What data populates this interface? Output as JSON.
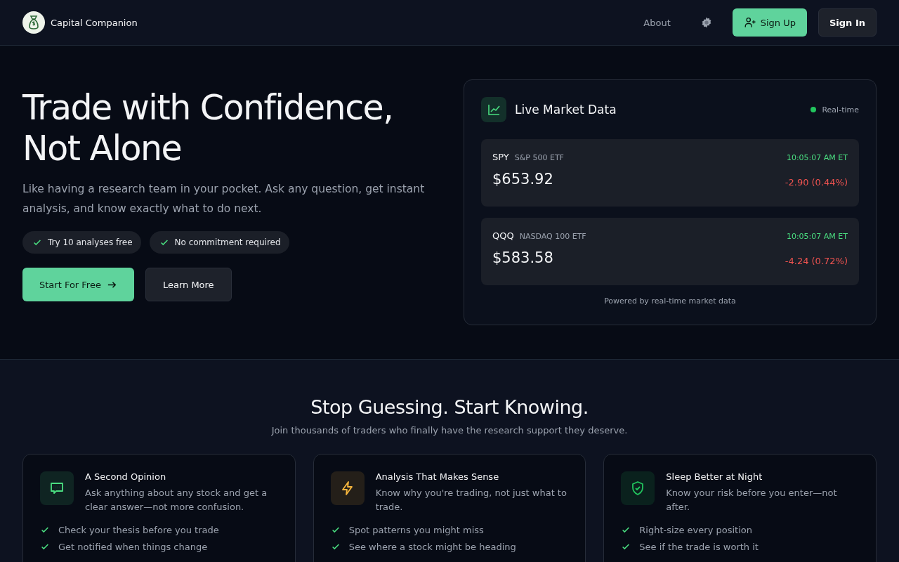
{
  "header": {
    "brand": "Capital Companion",
    "nav": [
      {
        "label": "About"
      }
    ],
    "sign_up": "Sign Up",
    "sign_in": "Sign In"
  },
  "hero": {
    "title_lines": [
      "Trade with Confidence,",
      "Not Alone"
    ],
    "subtitle": "Like having a research team in your pocket. Ask any question, get instant analysis, and know exactly what to do next.",
    "badges": [
      "Try 10 analyses free",
      "No commitment required"
    ],
    "primary_button": "Start For Free",
    "secondary_button": "Learn More"
  },
  "market": {
    "title": "Live Market Data",
    "status": "Real-time",
    "live": true,
    "quotes": [
      {
        "symbol": "SPY",
        "name": "S&P 500 ETF",
        "time": "10:05:07 AM ET",
        "price": "$653.92",
        "change": "-2.90 (0.44%)",
        "negative": true
      },
      {
        "symbol": "QQQ",
        "name": "NASDAQ 100 ETF",
        "time": "10:05:07 AM ET",
        "price": "$583.58",
        "change": "-4.24 (0.72%)",
        "negative": true
      }
    ],
    "footer": "Powered by real-time market data"
  },
  "features_section": {
    "title": "Stop Guessing. Start Knowing.",
    "subtitle": "Join thousands of traders who finally have the research support they deserve.",
    "features": [
      {
        "kind": "chat",
        "color": "#4ade80",
        "title": "A Second Opinion",
        "description": "Ask anything about any stock and get a clear answer—not more confusion.",
        "points": [
          "Check your thesis before you trade",
          "Get notified when things change"
        ]
      },
      {
        "kind": "bolt",
        "color": "#f5b53d",
        "title": "Analysis That Makes Sense",
        "description": "Know why you're trading, not just what to trade.",
        "points": [
          "Spot patterns you might miss",
          "See where a stock might be heading"
        ]
      },
      {
        "kind": "shield",
        "color": "#22c55e",
        "title": "Sleep Better at Night",
        "description": "Know your risk before you enter—not after.",
        "points": [
          "Right-size every position",
          "See if the trade is worth it"
        ]
      }
    ]
  }
}
